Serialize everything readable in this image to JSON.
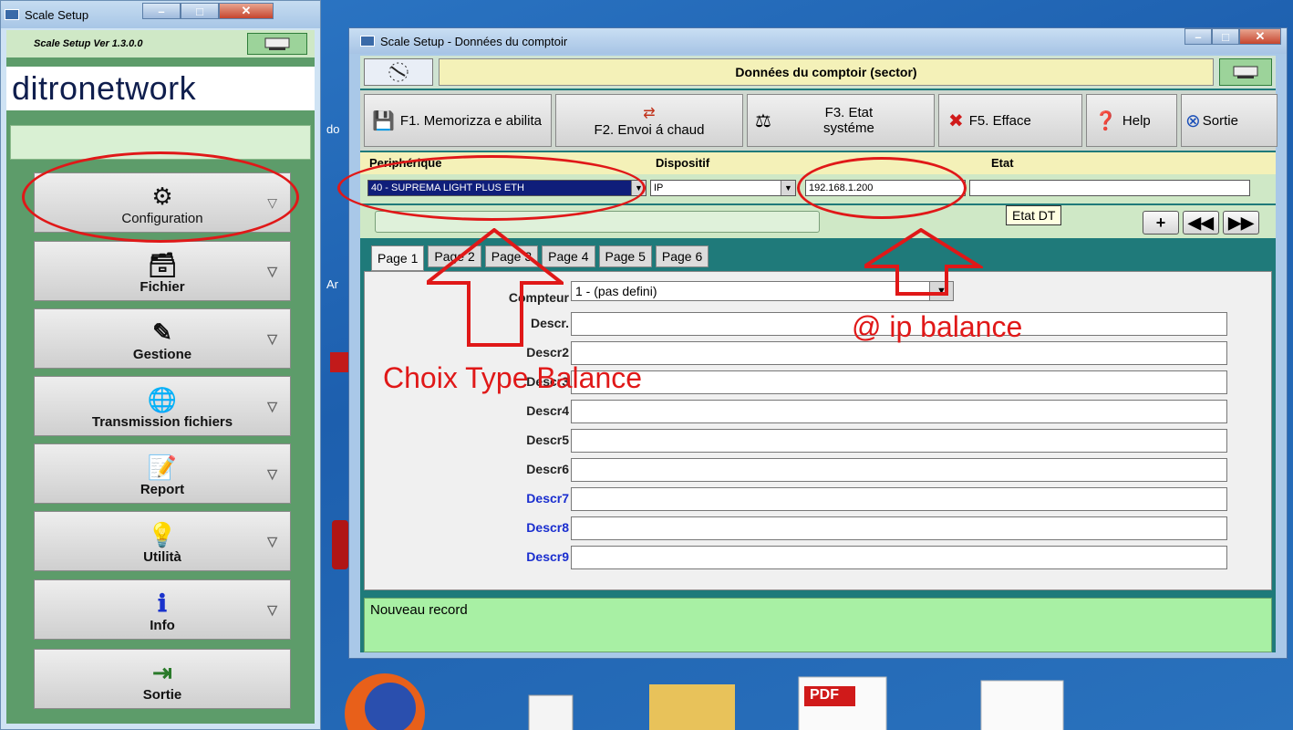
{
  "left_window": {
    "title": "Scale Setup",
    "version": "Scale Setup Ver 1.3.0.0",
    "logo": "ditronetwork",
    "menu": [
      {
        "label": "Configuration",
        "icon": "gear-icon"
      },
      {
        "label": "Fichier",
        "icon": "file-box-icon"
      },
      {
        "label": "Gestione",
        "icon": "edit-icon"
      },
      {
        "label": "Transmission fichiers",
        "icon": "globe-icon"
      },
      {
        "label": "Report",
        "icon": "report-icon"
      },
      {
        "label": "Utilità",
        "icon": "bulb-icon"
      },
      {
        "label": "Info",
        "icon": "info-icon"
      },
      {
        "label": "Sortie",
        "icon": "exit-icon"
      }
    ]
  },
  "main_window": {
    "title": "Scale Setup - Données du comptoir",
    "strip_title": "Données du comptoir  (sector)",
    "toolbar": {
      "f1": "F1. Memorizza e abilita",
      "f2": "F2. Envoi á chaud",
      "f3": "F3. Etat systéme",
      "f5": "F5. Efface",
      "help": "Help",
      "exit": "Sortie"
    },
    "columns": {
      "periph": "Periphérique",
      "dispositif": "Dispositif",
      "etat": "Etat"
    },
    "fields": {
      "periph_value": "40 - SUPREMA LIGHT PLUS ETH",
      "dispositif_value": "IP",
      "ip_value": "192.168.1.200",
      "etat_value": ""
    },
    "tooltip": "Etat DT",
    "tabs": [
      "Page 1",
      "Page 2",
      "Page 3",
      "Page 4",
      "Page 5",
      "Page 6"
    ],
    "form": {
      "compteur_label": "Compteur",
      "compteur_value": "1 - (pas defini)",
      "descr_labels": [
        "Descr.",
        "Descr2",
        "Descr3",
        "Descr4",
        "Descr5",
        "Descr6",
        "Descr7",
        "Descr8",
        "Descr9"
      ]
    },
    "status": "Nouveau record"
  },
  "annotations": {
    "ip_text": "@ ip balance",
    "type_text": "Choix Type Balance"
  },
  "desktop": {
    "pdf_label": "PDF"
  },
  "colors": {
    "annotation": "#e01818",
    "status_bg": "#a8f0a4",
    "title_strip": "#f4f1b8"
  }
}
